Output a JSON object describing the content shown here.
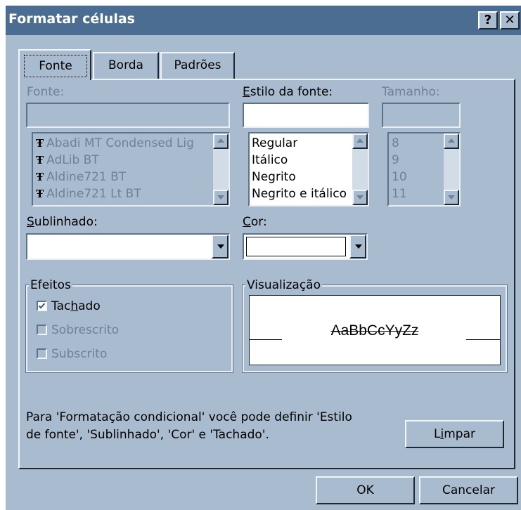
{
  "window": {
    "title": "Formatar células",
    "help_glyph": "?",
    "close_glyph": "✕"
  },
  "tabs": [
    {
      "label": "Fonte",
      "active": true
    },
    {
      "label": "Borda",
      "active": false
    },
    {
      "label": "Padrões",
      "active": false
    }
  ],
  "font": {
    "label": "Fonte:",
    "value": "",
    "list": [
      "Abadi MT Condensed Lig",
      "AdLib BT",
      "Aldine721 BT",
      "Aldine721 Lt BT"
    ]
  },
  "style": {
    "label_pre": "",
    "label_hot": "E",
    "label_post": "stilo da fonte:",
    "value": "",
    "list": [
      "Regular",
      "Itálico",
      "Negrito",
      "Negrito e itálico"
    ]
  },
  "size": {
    "label": "Tamanho:",
    "value": "",
    "list": [
      "8",
      "9",
      "10",
      "11"
    ]
  },
  "underline": {
    "label_hot": "S",
    "label_post": "ublinhado:",
    "value": ""
  },
  "color": {
    "label_hot": "C",
    "label_post": "or:",
    "value": ""
  },
  "effects": {
    "title": "Efeitos",
    "strike": {
      "pre": "Tac",
      "hot": "h",
      "post": "ado",
      "checked": true
    },
    "superscript": {
      "label": "Sobrescrito",
      "checked": false
    },
    "subscript": {
      "label": "Subscrito",
      "checked": false
    }
  },
  "preview": {
    "title": "Visualização",
    "sample": "AaBbCcYyZz"
  },
  "info_line1": "Para 'Formatação condicional' você pode definir 'Estilo",
  "info_line2": "de fonte', 'Sublinhado', 'Cor' e 'Tachado'.",
  "clear_button": {
    "pre": "L",
    "hot": "i",
    "post": "mpar"
  },
  "ok_button": "OK",
  "cancel_button": "Cancelar",
  "colors": {
    "titlebar": "#4b6d92",
    "face": "#a9bccf",
    "check": "#3c4f6b"
  }
}
